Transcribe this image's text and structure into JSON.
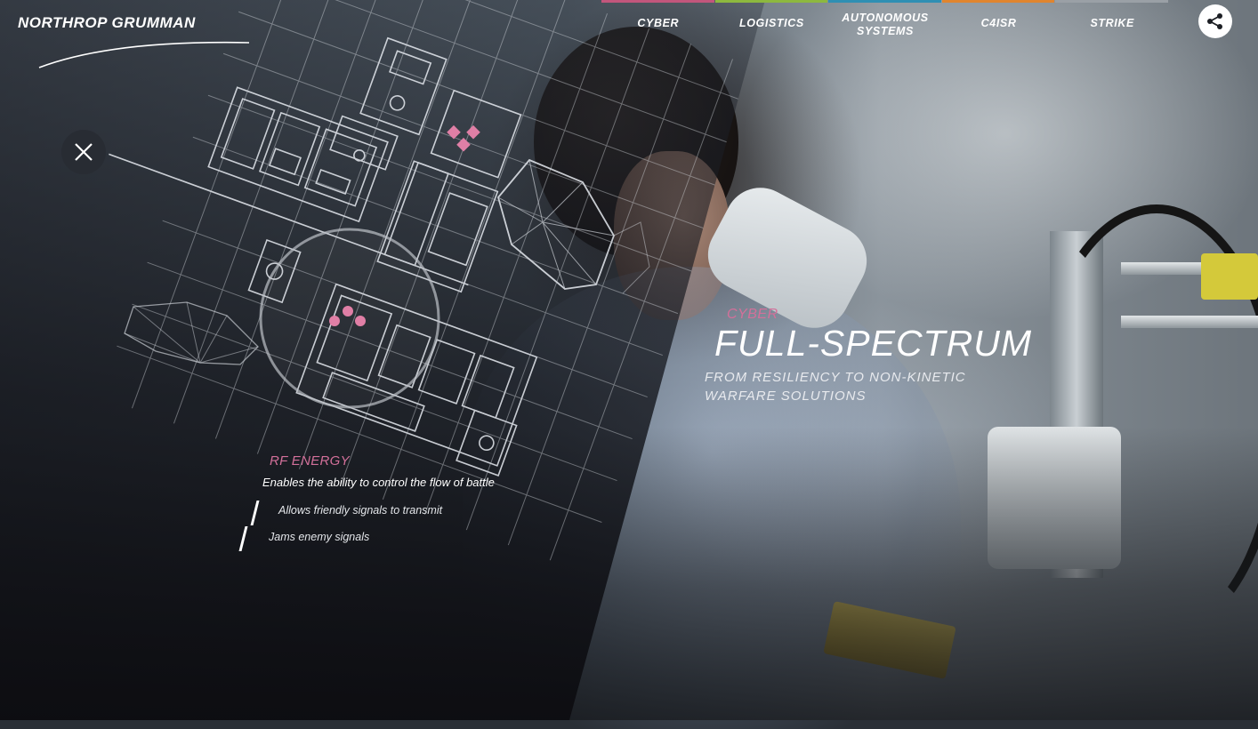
{
  "brand": {
    "logo_text": "NORTHROP GRUMMAN"
  },
  "nav": {
    "items": [
      {
        "label": "CYBER",
        "color": "#c2567c"
      },
      {
        "label": "LOGISTICS",
        "color": "#8db83f"
      },
      {
        "label": "AUTONOMOUS\nSYSTEMS",
        "color": "#2f8fb3"
      },
      {
        "label": "C4ISR",
        "color": "#e0852f"
      },
      {
        "label": "STRIKE",
        "color": "#9aa0a6"
      }
    ]
  },
  "controls": {
    "share_icon": "share-icon",
    "close_icon": "close-icon"
  },
  "hero": {
    "tag": "CYBER",
    "title": "FULL-SPECTRUM",
    "subtitle": "FROM RESILIENCY TO NON-KINETIC WARFARE SOLUTIONS"
  },
  "feature": {
    "title": "RF ENERGY",
    "description": "Enables the ability to control the flow of battle",
    "bullets": [
      "Allows friendly signals to transmit",
      "Jams enemy signals"
    ]
  },
  "colors": {
    "accent_pink": "#d3709a",
    "schematic_line": "#e6eaf0"
  }
}
